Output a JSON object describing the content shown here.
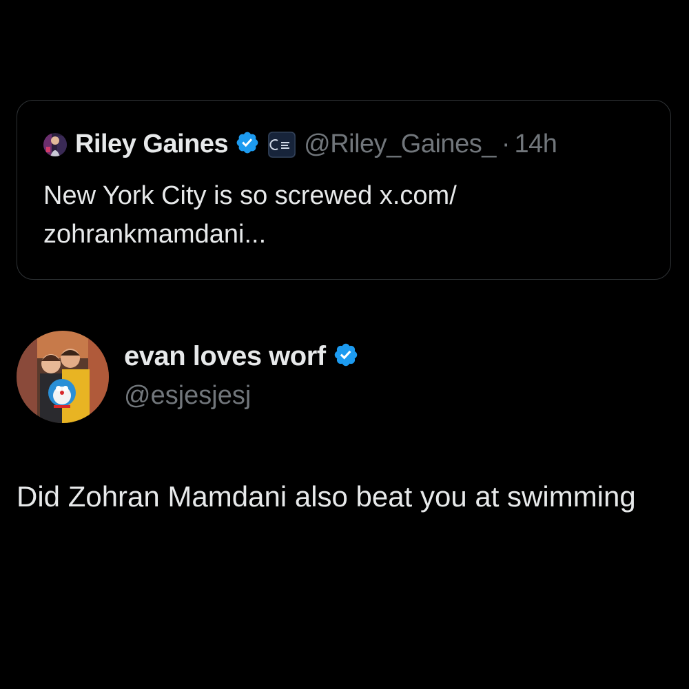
{
  "quoted_post": {
    "author_name": "Riley Gaines",
    "author_handle": "@Riley_Gaines_",
    "separator": "·",
    "timestamp": "14h",
    "text_before_link": "New York City is so screwed ",
    "link_text": "x.com/ zohrankmamdani...",
    "icons": {
      "avatar": "avatar-photo",
      "verified": "verified-badge-icon",
      "affiliation": "affiliation-badge"
    }
  },
  "reply_post": {
    "author_name": "evan loves worf",
    "author_handle": "@esjesjesj",
    "text": "Did Zohran Mamdani also beat you at swimming",
    "icons": {
      "avatar": "avatar-photo",
      "verified": "verified-badge-icon"
    }
  },
  "colors": {
    "background": "#000000",
    "primary_text": "#e7e9ea",
    "secondary_text": "#71767b",
    "verified_blue": "#1d9bf0",
    "card_border": "#2f3336"
  }
}
